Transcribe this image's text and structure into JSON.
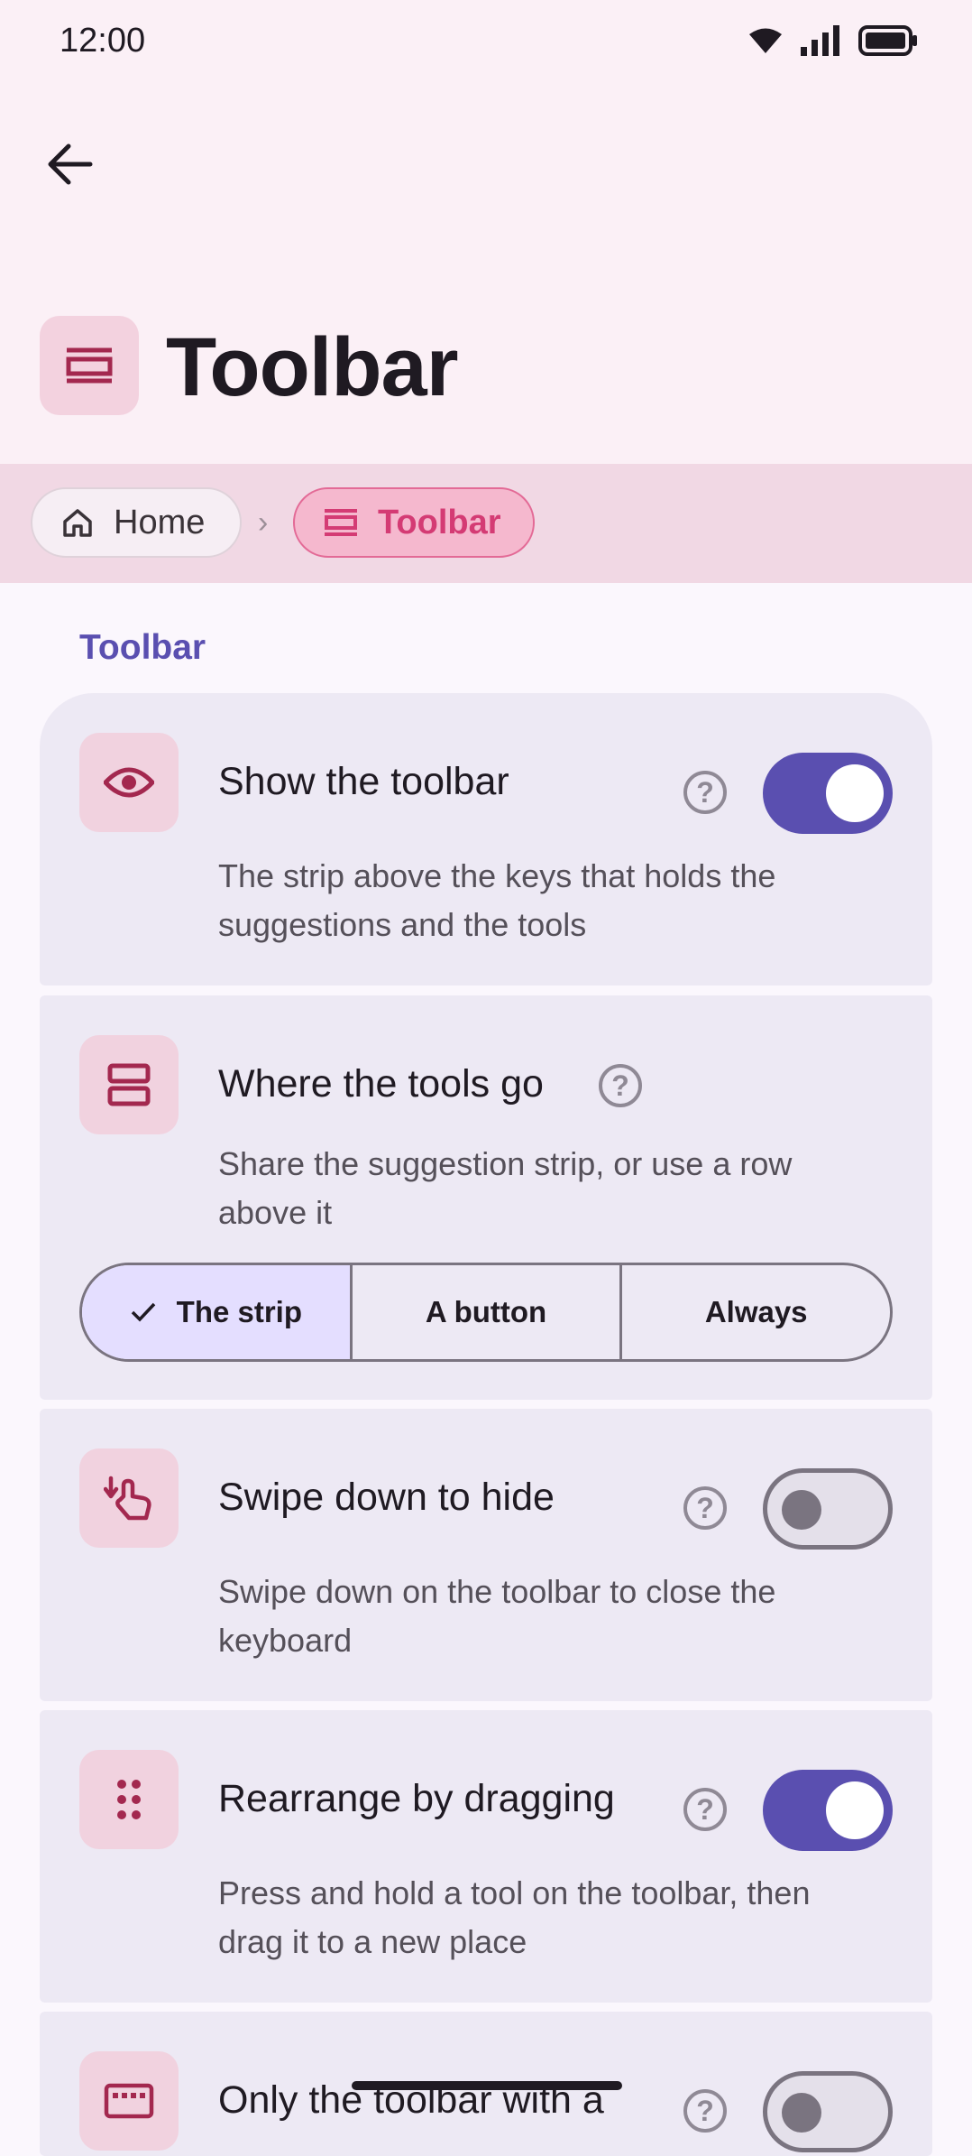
{
  "status_bar": {
    "time": "12:00"
  },
  "header": {
    "title": "Toolbar"
  },
  "breadcrumb": {
    "home": "Home",
    "current": "Toolbar"
  },
  "section": {
    "label": "Toolbar"
  },
  "settings": [
    {
      "title": "Show the toolbar",
      "description": "The strip above the keys that holds the suggestions and the tools",
      "toggle": "on"
    },
    {
      "title": "Where the tools go",
      "description": "Share the suggestion strip, or use a row above it",
      "options": [
        "The strip",
        "A button",
        "Always"
      ],
      "selected": "The strip"
    },
    {
      "title": "Swipe down to hide",
      "description": "Swipe down on the toolbar to close the keyboard",
      "toggle": "off"
    },
    {
      "title": "Rearrange by dragging",
      "description": "Press and hold a tool on the toolbar, then drag it to a new place",
      "toggle": "on"
    },
    {
      "title": "Only the toolbar with a",
      "toggle": "off"
    }
  ],
  "colors": {
    "accent": "#5a4fb0",
    "brand_pink": "#d43b74",
    "icon_color": "#a3284f"
  }
}
